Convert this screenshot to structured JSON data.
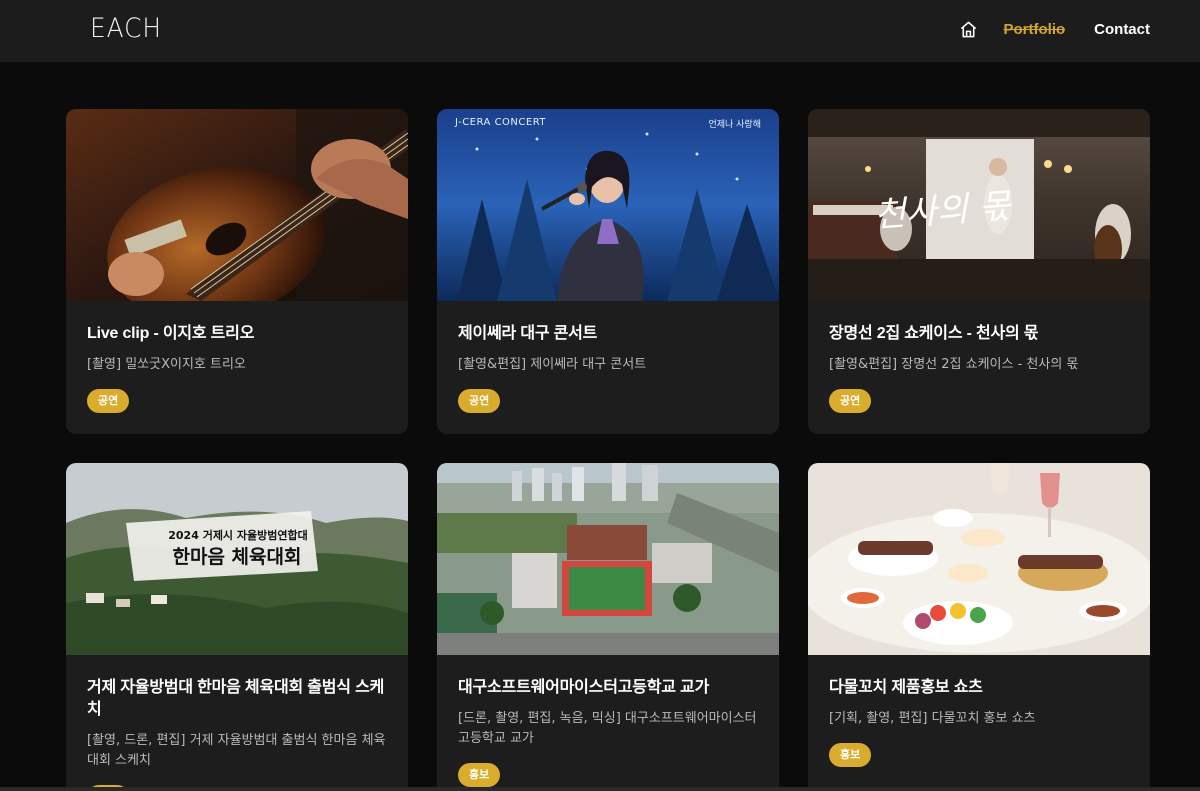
{
  "header": {
    "logo": "EACH",
    "nav": [
      {
        "label": "Portfolio",
        "active": true
      },
      {
        "label": "Contact",
        "active": false
      }
    ]
  },
  "cards": [
    {
      "title": "Live clip - 이지호 트리오",
      "desc": "[촬영] 밀쏘굿X이지호 트리오",
      "tag": "공연",
      "thumb": "guitar-performance"
    },
    {
      "title": "제이쎄라 대구 콘서트",
      "desc": "[촬영&편집] 제이쎄라 대구 콘서트",
      "tag": "공연",
      "thumb": "singer-concert",
      "overlay_left": "J-CERA CONCERT",
      "overlay_right": "언제나 사랑해"
    },
    {
      "title": "장명선 2집 쇼케이스 - 천사의 몫",
      "desc": "[촬영&편집] 장명선 2집 쇼케이스 - 천사의 몫",
      "tag": "공연",
      "thumb": "showcase-stage",
      "overlay_text": "천사의 몫"
    },
    {
      "title": "거제 자율방범대 한마음 체육대회 출범식 스케치",
      "desc": "[촬영, 드론, 편집] 거제 자율방범대 출범식 한마음 체육대회 스케치",
      "tag": "행사",
      "thumb": "drone-mountain",
      "overlay_line1": "2024 거제시 자율방범연합대",
      "overlay_line2": "한마음 체육대회"
    },
    {
      "title": "대구소프트웨어마이스터고등학교 교가",
      "desc": "[드론, 촬영, 편집, 녹음, 믹싱] 대구소프트웨어마이스터고등학교 교가",
      "tag": "홍보",
      "thumb": "school-aerial"
    },
    {
      "title": "다물꼬치 제품홍보 쇼츠",
      "desc": "[기획, 촬영, 편집] 다물꼬치 홍보 쇼츠",
      "tag": "홍보",
      "thumb": "skewer-food"
    }
  ],
  "colors": {
    "accent": "#d9ac2e",
    "background": "#0b0b0b",
    "card": "#1d1d1d",
    "header": "#1c1c1c"
  }
}
